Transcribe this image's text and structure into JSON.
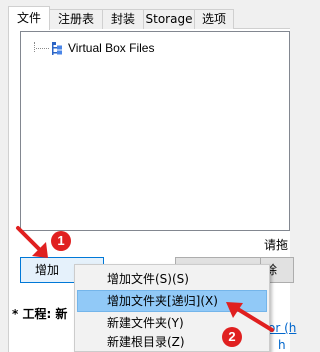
{
  "tabs": [
    {
      "label": "文件",
      "active": true
    },
    {
      "label": "注册表",
      "active": false
    },
    {
      "label": "封装",
      "active": false
    },
    {
      "label": "Storage",
      "active": false
    },
    {
      "label": "选项",
      "active": false
    }
  ],
  "tree": {
    "root_label": "Virtual Box Files",
    "root_icon": "folder-tree-icon"
  },
  "drag_hint": "请拖",
  "buttons": {
    "add": "增加",
    "middle": "",
    "remove": "除"
  },
  "project_label": "* 工程: 新",
  "link_tail": "or (h",
  "link_tail2": "h",
  "context_menu": {
    "items": [
      {
        "label": "增加文件(S)(S)",
        "highlighted": false
      },
      {
        "label": "增加文件夹[递归](X)",
        "highlighted": true
      },
      {
        "label": "新建文件夹(Y)",
        "highlighted": false
      },
      {
        "label": "新建根目录(Z)",
        "highlighted": false
      }
    ]
  },
  "annotations": {
    "badge1": "1",
    "badge2": "2",
    "color": "#e02020"
  }
}
